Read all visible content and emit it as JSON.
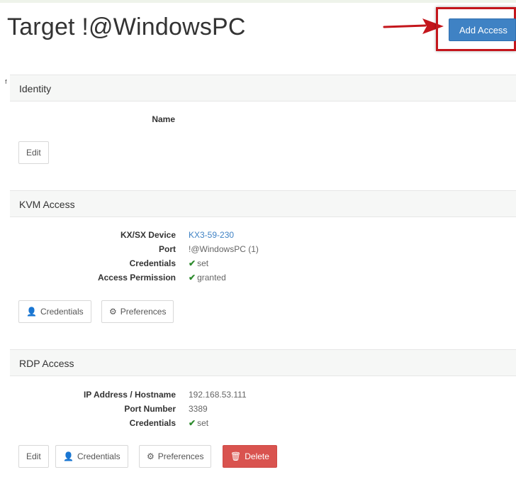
{
  "page": {
    "title": "Target !@WindowsPC",
    "add_access_label": "Add Access"
  },
  "identity": {
    "heading": "Identity",
    "name_label": "Name",
    "name_value": "",
    "edit_label": "Edit"
  },
  "kvm": {
    "heading": "KVM Access",
    "fields": [
      {
        "label": "KX/SX Device",
        "value": "KX3-59-230"
      },
      {
        "label": "Port",
        "value": "!@WindowsPC (1)"
      },
      {
        "label": "Credentials",
        "value": "set"
      },
      {
        "label": "Access Permission",
        "value": "granted"
      }
    ],
    "buttons": {
      "credentials": "Credentials",
      "preferences": "Preferences"
    }
  },
  "rdp": {
    "heading": "RDP Access",
    "fields": [
      {
        "label": "IP Address / Hostname",
        "value": "192.168.53.111"
      },
      {
        "label": "Port Number",
        "value": "3389"
      },
      {
        "label": "Credentials",
        "value": "set"
      }
    ],
    "buttons": {
      "edit": "Edit",
      "credentials": "Credentials",
      "preferences": "Preferences",
      "delete": "Delete"
    }
  },
  "colors": {
    "primary": "#3f82c4",
    "danger": "#d9534f",
    "success": "#2e8b2e",
    "highlight": "#c4161c"
  },
  "icons": [
    "arrow-right-icon",
    "user-icon",
    "gear-icon",
    "trash-icon",
    "check-icon"
  ]
}
